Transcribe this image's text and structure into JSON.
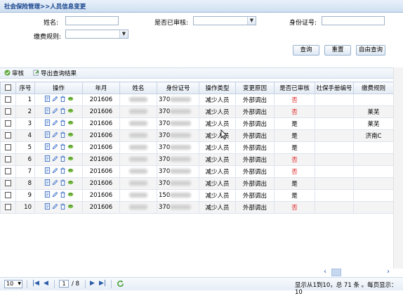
{
  "title": "社会保险管理>>人员信息变更",
  "form": {
    "name_label": "姓名:",
    "audited_label": "是否已审核:",
    "id_label": "身份证号:",
    "fee_rule_label": "缴费规则:",
    "query_btn": "查询",
    "reset_btn": "重置",
    "free_query_btn": "自由查询"
  },
  "toolbar": {
    "audit_label": "审核",
    "export_label": "导出查询结果"
  },
  "table": {
    "columns": [
      "序号",
      "操作",
      "年月",
      "姓名",
      "身份证号",
      "操作类型",
      "变更原因",
      "是否已审核",
      "社保手册编号",
      "缴费规则"
    ],
    "rows": [
      {
        "no": "1",
        "ym": "201606",
        "id": "370",
        "type": "减少人员",
        "reason": "外部调出",
        "audited": "否",
        "manual": "",
        "rule": ""
      },
      {
        "no": "2",
        "ym": "201606",
        "id": "370",
        "type": "减少人员",
        "reason": "外部调出",
        "audited": "否",
        "manual": "",
        "rule": "莱芜"
      },
      {
        "no": "3",
        "ym": "201606",
        "id": "370",
        "type": "减少人员",
        "reason": "外部调出",
        "audited": "是",
        "manual": "",
        "rule": "莱芜"
      },
      {
        "no": "4",
        "ym": "201606",
        "id": "370",
        "type": "减少人员",
        "reason": "外部调出",
        "audited": "是",
        "manual": "",
        "rule": "济南C"
      },
      {
        "no": "5",
        "ym": "201606",
        "id": "370",
        "type": "减少人员",
        "reason": "外部调出",
        "audited": "是",
        "manual": "",
        "rule": ""
      },
      {
        "no": "6",
        "ym": "201606",
        "id": "370",
        "type": "减少人员",
        "reason": "外部调出",
        "audited": "否",
        "manual": "",
        "rule": ""
      },
      {
        "no": "7",
        "ym": "201606",
        "id": "370",
        "type": "减少人员",
        "reason": "外部调出",
        "audited": "否",
        "manual": "",
        "rule": ""
      },
      {
        "no": "8",
        "ym": "201606",
        "id": "370",
        "type": "减少人员",
        "reason": "外部调出",
        "audited": "是",
        "manual": "",
        "rule": ""
      },
      {
        "no": "9",
        "ym": "201606",
        "id": "150",
        "type": "减少人员",
        "reason": "外部调出",
        "audited": "是",
        "manual": "",
        "rule": ""
      },
      {
        "no": "10",
        "ym": "201606",
        "id": "370",
        "type": "减少人员",
        "reason": "外部调出",
        "audited": "否",
        "manual": "",
        "rule": ""
      }
    ]
  },
  "pager": {
    "page_size": "10",
    "current_page": "1",
    "total_pages": "/ 8",
    "summary": "显示从1到10，总 71 条 。每页显示：10"
  },
  "colors": {
    "accent": "#15428b",
    "no_color": "#e02020",
    "header_bg": "#e4ebf4"
  }
}
